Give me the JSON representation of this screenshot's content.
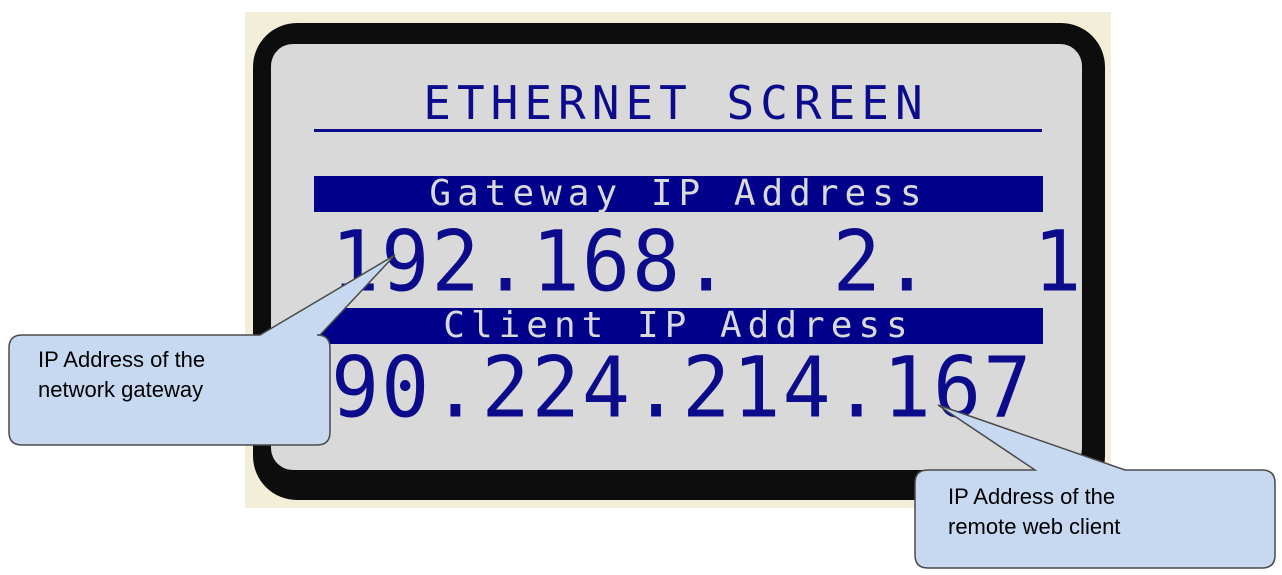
{
  "screen": {
    "title": "ETHERNET SCREEN",
    "gateway": {
      "label": "Gateway IP Address",
      "value": "192.168.  2.  1"
    },
    "client": {
      "label": "Client IP Address",
      "value": "90.224.214.167"
    }
  },
  "callouts": {
    "gateway": {
      "line1": "IP Address of the",
      "line2": "network gateway"
    },
    "client": {
      "line1": "IP Address of the",
      "line2": "remote web client"
    }
  },
  "colors": {
    "lcd_text": "#0b0b8c",
    "label_bar": "#00008b",
    "lcd_background": "#d9d9d9",
    "bezel": "#0d0d0d",
    "callout_fill": "#c6d9f1"
  }
}
